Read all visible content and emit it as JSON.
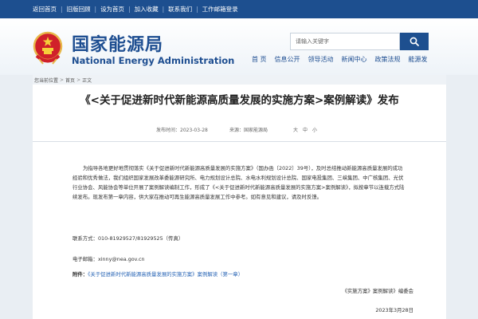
{
  "topbar": {
    "links": [
      "返回首页",
      "旧版回顾",
      "设为首页",
      "加入收藏",
      "联系我们",
      "工作邮箱登录"
    ]
  },
  "header": {
    "title_cn": "国家能源局",
    "title_en": "National Energy Administration",
    "emblem_icon": "national-emblem-icon"
  },
  "search": {
    "placeholder": "请输入关键字",
    "icon": "magnifier-icon"
  },
  "nav": {
    "items": [
      "首 页",
      "信息公开",
      "领导活动",
      "新闻中心",
      "政策法规",
      "能源发"
    ]
  },
  "breadcrumb": {
    "items": [
      "您当前位置",
      "首页",
      "正文"
    ]
  },
  "article": {
    "title": "《<关于促进新时代新能源高质量发展的实施方案>案例解读》发布",
    "published": "发布时间：2023-03-28",
    "source": "来源：国家能源局",
    "font_sizes": [
      "大",
      "中",
      "小"
    ],
    "paragraph": "为指导各地更好地贯彻落实《关于促进新时代新能源高质量发展的实施方案》（国办函〔2022〕39号），及时总结推动新能源高质量发展的成功经验和优秀做法，我们组织国家发展改革委能源研究所、电力规划设计总院、水电水利规划设计总院、国家电投集团、三峡集团、中广核集团、光伏行业协会、风能协会等单位开展了案例解读编制工作，形成了《<关于促进新时代新能源高质量发展的实施方案>案例解读》，拟按章节以连载方式陆续发布。现发布第一章内容，供大家在推动可再生能源高质量发展工作中参考。如有意见和建议，请及时反馈。",
    "contact": "联系方式：010-81929527/81929525（传真）",
    "email": "电子邮箱：xinny@nea.gov.cn",
    "attachment_label": "附件：",
    "attachment_link": "《关于促进新时代新能源高质量发展的实施方案》案例解读（第一章）",
    "signature": "《实施方案》案例解读》编委会",
    "date": "2023年3月28日"
  },
  "colors": {
    "brand_blue": "#1d4f8f",
    "link_blue": "#2764b5",
    "background": "#e9eef3"
  }
}
